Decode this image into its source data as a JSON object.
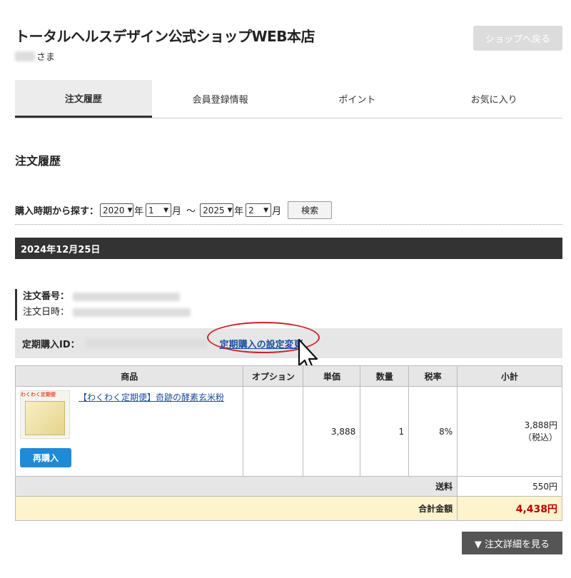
{
  "header": {
    "shop_title": "トータルヘルスデザイン公式ショップWEB本店",
    "greeting_suffix": "さま",
    "back_button": "ショップへ戻る"
  },
  "tabs": [
    {
      "label": "注文履歴",
      "active": true
    },
    {
      "label": "会員登録情報",
      "active": false
    },
    {
      "label": "ポイント",
      "active": false
    },
    {
      "label": "お気に入り",
      "active": false
    }
  ],
  "section_title": "注文履歴",
  "search": {
    "label": "購入時期から探す：",
    "from_year": "2020",
    "from_month": "1",
    "to_year": "2025",
    "to_month": "2",
    "year_unit": "年",
    "month_unit": "月",
    "tilde": "～",
    "button": "検索"
  },
  "order": {
    "date": "2024年12月25日",
    "order_number_label": "注文番号：",
    "order_date_label": "注文日時：",
    "subscription_label": "定期購入ID：",
    "change_link": "定期購入の設定変更",
    "table_headers": [
      "商品",
      "オプション",
      "単価",
      "数量",
      "税率",
      "小計"
    ],
    "item": {
      "name": "【わくわく定期便】奇跡の酵素玄米粉",
      "thumb_tag": "わくわく定期便",
      "rebuy_button": "再購入",
      "unit_price": "3,888",
      "quantity": "1",
      "tax_rate": "8%",
      "subtotal": "3,888円",
      "tax_note": "（税込）"
    },
    "shipping_label": "送料",
    "shipping_value": "550円",
    "total_label": "合計金額",
    "total_value": "4,438円",
    "detail_button": "▼ 注文詳細を見る"
  },
  "colors": {
    "accent_link": "#1a4fa0",
    "rebuy_button": "#1f8ad6",
    "total_red": "#c00000",
    "highlight_ellipse": "#d0212a"
  },
  "icons": {
    "cursor": "hand-pointer-icon",
    "select_arrow": "chevron-down-icon"
  }
}
